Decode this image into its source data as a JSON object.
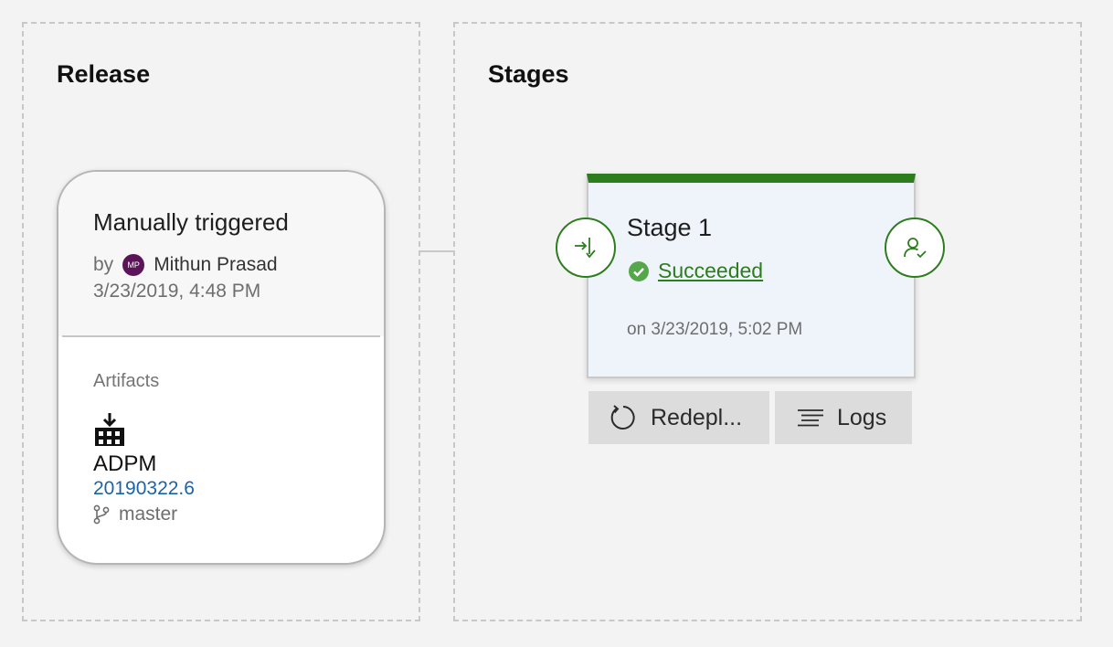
{
  "release": {
    "title": "Release",
    "trigger_title": "Manually triggered",
    "by_label": "by",
    "user_initials": "MP",
    "user_name": "Mithun Prasad",
    "trigger_date": "3/23/2019, 4:48 PM",
    "artifacts_label": "Artifacts",
    "artifact_name": "ADPM",
    "artifact_version": "20190322.6",
    "artifact_branch": "master",
    "icons": {
      "artifact": "build-artifact-icon",
      "branch": "branch-icon"
    }
  },
  "stages": {
    "title": "Stages",
    "stage": {
      "name": "Stage 1",
      "status": "Succeeded",
      "date": "on 3/23/2019, 5:02 PM",
      "icons": {
        "pre": "pre-deployment-conditions-icon",
        "post": "post-deployment-approver-icon",
        "status": "check-circle-icon"
      }
    },
    "actions": {
      "redeploy_label": "Redepl...",
      "logs_label": "Logs"
    }
  },
  "colors": {
    "success": "#2d7d1f",
    "link": "#1b63a8",
    "avatar": "#5c1458"
  }
}
